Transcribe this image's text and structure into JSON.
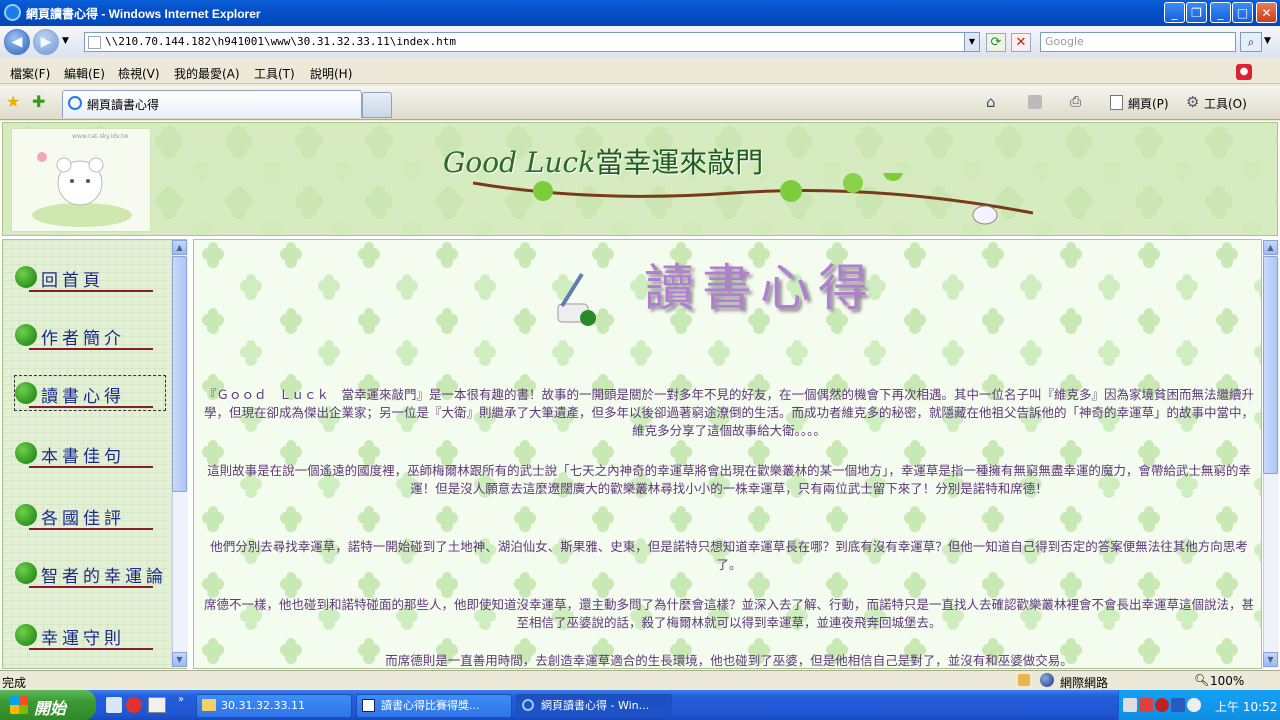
{
  "window": {
    "title": "網頁讀書心得 - Windows Internet Explorer",
    "controls": {
      "minimize": "_",
      "maximize": "□",
      "restore": "❐",
      "close": "✕"
    }
  },
  "toolbar": {
    "address": "\\\\210.70.144.182\\h941001\\www\\30.31.32.33.11\\index.htm",
    "search_placeholder": "Google"
  },
  "menu": [
    "檔案(F)",
    "編輯(E)",
    "檢視(V)",
    "我的最愛(A)",
    "工具(T)",
    "說明(H)"
  ],
  "tabs": {
    "active_label": "網頁讀書心得",
    "right_tools": {
      "page": "網頁(P)",
      "tools": "工具(O)"
    }
  },
  "banner": {
    "logo_text": "www.cat-sky.idv.tw",
    "title_script": "Good Luck",
    "title_main": "當幸運來敲門"
  },
  "sidebar": {
    "items": [
      {
        "label": "回首頁"
      },
      {
        "label": "作者簡介"
      },
      {
        "label": "讀書心得"
      },
      {
        "label": "本書佳句"
      },
      {
        "label": "各國佳評"
      },
      {
        "label": "智者的幸運論"
      },
      {
        "label": "幸運守則"
      }
    ]
  },
  "content": {
    "title": "讀書心得",
    "paragraphs": [
      "『Ｇｏｏｄ　Ｌｕｃｋ　當幸運來敲門』是一本很有趣的書！故事的一開頭是關於一對多年不見的好友，在一個偶然的機會下再次相遇。其中一位名子叫『維克多』因為家境貧困而無法繼續升學，但現在卻成為傑出企業家；另一位是『大衛』則繼承了大筆遺產，但多年以後卻過著窮途潦倒的生活。而成功者維克多的秘密，就隱藏在他祖父告訴他的「神奇的幸運草」的故事中當中，維克多分享了這個故事給大衛。。。。",
      "這則故事是在說一個遙遠的國度裡，巫師梅爾林跟所有的武士說「七天之內神奇的幸運草將會出現在歡樂叢林的某一個地方」，幸運草是指一種擁有無窮無盡幸運的魔力，會帶給武士無窮的幸運！但是沒人願意去這麼遼闊廣大的歡樂叢林尋找小小的一株幸運草，只有兩位武士留下來了！分別是諾特和席德！",
      "他們分別去尋找幸運草，諾特一開始碰到了土地神、湖泊仙女、斯果雅、史東，但是諾特只想知道幸運草長在哪？到底有沒有幸運草？但他一知道自己得到否定的答案便無法往其他方向思考了。",
      "席德不一樣，他也碰到和諾特碰面的那些人，他即使知道沒幸運草，還主動多問了為什麼會這樣？並深入去了解、行動，而諾特只是一直找人去確認歡樂叢林裡會不會長出幸運草這個說法，甚至相信了巫婆說的話，殺了梅爾林就可以得到幸運草，並連夜飛奔回城堡去。",
      "而席德則是一直善用時間，去創造幸運草適合的生長環境，他也碰到了巫婆，但是他相信自己是對了，並沒有和巫婆做交易。"
    ]
  },
  "statusbar": {
    "status": "完成",
    "zone": "網際網路",
    "zoom": "100%"
  },
  "taskbar": {
    "start": "開始",
    "buttons": [
      "30.31.32.33.11",
      "讀書心得比賽得獎...",
      "網頁讀書心得 - Win..."
    ],
    "clock": "上午 10:52"
  }
}
